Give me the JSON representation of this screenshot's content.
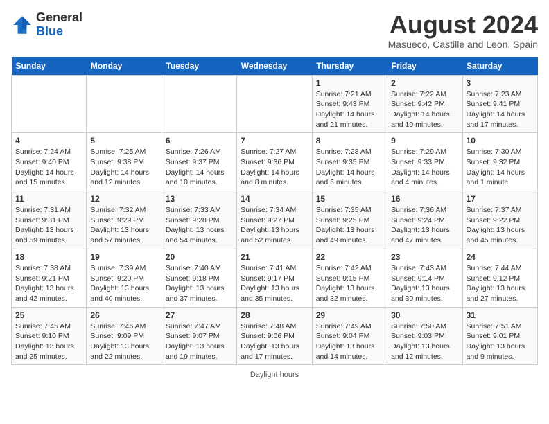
{
  "header": {
    "logo_line1": "General",
    "logo_line2": "Blue",
    "month_year": "August 2024",
    "location": "Masueco, Castille and Leon, Spain"
  },
  "weekdays": [
    "Sunday",
    "Monday",
    "Tuesday",
    "Wednesday",
    "Thursday",
    "Friday",
    "Saturday"
  ],
  "weeks": [
    [
      {
        "day": "",
        "info": ""
      },
      {
        "day": "",
        "info": ""
      },
      {
        "day": "",
        "info": ""
      },
      {
        "day": "",
        "info": ""
      },
      {
        "day": "1",
        "info": "Sunrise: 7:21 AM\nSunset: 9:43 PM\nDaylight: 14 hours and 21 minutes."
      },
      {
        "day": "2",
        "info": "Sunrise: 7:22 AM\nSunset: 9:42 PM\nDaylight: 14 hours and 19 minutes."
      },
      {
        "day": "3",
        "info": "Sunrise: 7:23 AM\nSunset: 9:41 PM\nDaylight: 14 hours and 17 minutes."
      }
    ],
    [
      {
        "day": "4",
        "info": "Sunrise: 7:24 AM\nSunset: 9:40 PM\nDaylight: 14 hours and 15 minutes."
      },
      {
        "day": "5",
        "info": "Sunrise: 7:25 AM\nSunset: 9:38 PM\nDaylight: 14 hours and 12 minutes."
      },
      {
        "day": "6",
        "info": "Sunrise: 7:26 AM\nSunset: 9:37 PM\nDaylight: 14 hours and 10 minutes."
      },
      {
        "day": "7",
        "info": "Sunrise: 7:27 AM\nSunset: 9:36 PM\nDaylight: 14 hours and 8 minutes."
      },
      {
        "day": "8",
        "info": "Sunrise: 7:28 AM\nSunset: 9:35 PM\nDaylight: 14 hours and 6 minutes."
      },
      {
        "day": "9",
        "info": "Sunrise: 7:29 AM\nSunset: 9:33 PM\nDaylight: 14 hours and 4 minutes."
      },
      {
        "day": "10",
        "info": "Sunrise: 7:30 AM\nSunset: 9:32 PM\nDaylight: 14 hours and 1 minute."
      }
    ],
    [
      {
        "day": "11",
        "info": "Sunrise: 7:31 AM\nSunset: 9:31 PM\nDaylight: 13 hours and 59 minutes."
      },
      {
        "day": "12",
        "info": "Sunrise: 7:32 AM\nSunset: 9:29 PM\nDaylight: 13 hours and 57 minutes."
      },
      {
        "day": "13",
        "info": "Sunrise: 7:33 AM\nSunset: 9:28 PM\nDaylight: 13 hours and 54 minutes."
      },
      {
        "day": "14",
        "info": "Sunrise: 7:34 AM\nSunset: 9:27 PM\nDaylight: 13 hours and 52 minutes."
      },
      {
        "day": "15",
        "info": "Sunrise: 7:35 AM\nSunset: 9:25 PM\nDaylight: 13 hours and 49 minutes."
      },
      {
        "day": "16",
        "info": "Sunrise: 7:36 AM\nSunset: 9:24 PM\nDaylight: 13 hours and 47 minutes."
      },
      {
        "day": "17",
        "info": "Sunrise: 7:37 AM\nSunset: 9:22 PM\nDaylight: 13 hours and 45 minutes."
      }
    ],
    [
      {
        "day": "18",
        "info": "Sunrise: 7:38 AM\nSunset: 9:21 PM\nDaylight: 13 hours and 42 minutes."
      },
      {
        "day": "19",
        "info": "Sunrise: 7:39 AM\nSunset: 9:20 PM\nDaylight: 13 hours and 40 minutes."
      },
      {
        "day": "20",
        "info": "Sunrise: 7:40 AM\nSunset: 9:18 PM\nDaylight: 13 hours and 37 minutes."
      },
      {
        "day": "21",
        "info": "Sunrise: 7:41 AM\nSunset: 9:17 PM\nDaylight: 13 hours and 35 minutes."
      },
      {
        "day": "22",
        "info": "Sunrise: 7:42 AM\nSunset: 9:15 PM\nDaylight: 13 hours and 32 minutes."
      },
      {
        "day": "23",
        "info": "Sunrise: 7:43 AM\nSunset: 9:14 PM\nDaylight: 13 hours and 30 minutes."
      },
      {
        "day": "24",
        "info": "Sunrise: 7:44 AM\nSunset: 9:12 PM\nDaylight: 13 hours and 27 minutes."
      }
    ],
    [
      {
        "day": "25",
        "info": "Sunrise: 7:45 AM\nSunset: 9:10 PM\nDaylight: 13 hours and 25 minutes."
      },
      {
        "day": "26",
        "info": "Sunrise: 7:46 AM\nSunset: 9:09 PM\nDaylight: 13 hours and 22 minutes."
      },
      {
        "day": "27",
        "info": "Sunrise: 7:47 AM\nSunset: 9:07 PM\nDaylight: 13 hours and 19 minutes."
      },
      {
        "day": "28",
        "info": "Sunrise: 7:48 AM\nSunset: 9:06 PM\nDaylight: 13 hours and 17 minutes."
      },
      {
        "day": "29",
        "info": "Sunrise: 7:49 AM\nSunset: 9:04 PM\nDaylight: 13 hours and 14 minutes."
      },
      {
        "day": "30",
        "info": "Sunrise: 7:50 AM\nSunset: 9:03 PM\nDaylight: 13 hours and 12 minutes."
      },
      {
        "day": "31",
        "info": "Sunrise: 7:51 AM\nSunset: 9:01 PM\nDaylight: 13 hours and 9 minutes."
      }
    ]
  ],
  "legend": "Daylight hours"
}
